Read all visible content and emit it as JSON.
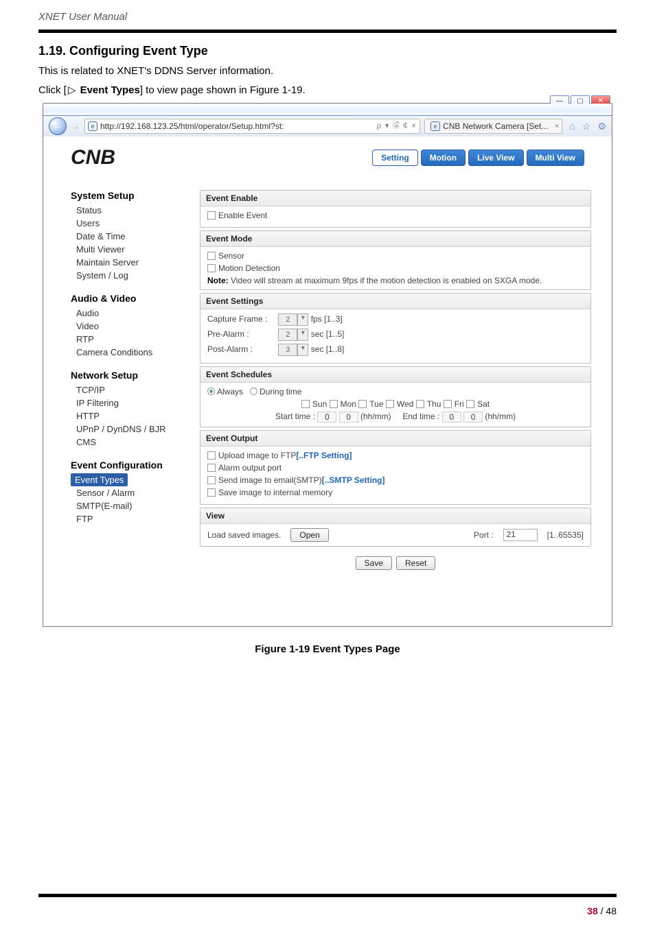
{
  "doc": {
    "header": "XNET User Manual",
    "section_number_title": "1.19. Configuring Event Type",
    "intro_line1": "This is related to XNET's DDNS Server information.",
    "intro_line2_prefix": "Click [",
    "intro_line2_bold": "Event Types",
    "intro_line2_suffix": "] to view page shown in Figure 1-19.",
    "triangle": "▷",
    "caption": "Figure 1-19 Event Types Page",
    "page_label_strong": "38",
    "page_label_rest": " / 48"
  },
  "browser": {
    "url": "http://192.168.123.25/html/operator/Setup.html?st:",
    "url_tail": "ρ ▾ 🗟 ¢ ×",
    "tab_title": "CNB Network Camera [Set...",
    "tab_close": "×",
    "win_min": "—",
    "win_max": "▢",
    "win_close": "✕",
    "toolicons": {
      "home": "⌂",
      "star": "☆",
      "gear": "⚙"
    }
  },
  "band": {
    "logo": "CNB",
    "buttons": {
      "setting": "Setting",
      "motion": "Motion",
      "liveview": "Live View",
      "multiview": "Multi View"
    }
  },
  "sidebar": {
    "groups": [
      {
        "heading": "System Setup",
        "items": [
          "Status",
          "Users",
          "Date & Time",
          "Multi Viewer",
          "Maintain Server",
          "System / Log"
        ]
      },
      {
        "heading": "Audio & Video",
        "items": [
          "Audio",
          "Video",
          "RTP",
          "Camera Conditions"
        ]
      },
      {
        "heading": "Network Setup",
        "items": [
          "TCP/IP",
          "IP Filtering",
          "HTTP",
          "UPnP / DynDNS / BJR",
          "CMS"
        ]
      },
      {
        "heading": "Event Configuration",
        "items": [
          "Event Types",
          "Sensor / Alarm",
          "SMTP(E-mail)",
          "FTP"
        ],
        "active_index": 0
      }
    ]
  },
  "panel": {
    "event_enable": {
      "heading": "Event Enable",
      "enable_label": "Enable Event"
    },
    "event_mode": {
      "heading": "Event Mode",
      "sensor_label": "Sensor",
      "motion_label": "Motion Detection",
      "note_bold": "Note:",
      "note_text": " Video will stream at maximum 9fps if the motion detection is enabled on SXGA mode."
    },
    "event_settings": {
      "heading": "Event Settings",
      "capture_label": "Capture Frame :",
      "capture_val": "2",
      "capture_unit": "fps [1..3]",
      "prealarm_label": "Pre-Alarm :",
      "prealarm_val": "2",
      "prealarm_unit": "sec [1..5]",
      "postalarm_label": "Post-Alarm :",
      "postalarm_val": "3",
      "postalarm_unit": "sec [1..8]"
    },
    "event_schedules": {
      "heading": "Event Schedules",
      "always_label": "Always",
      "during_label": "During time",
      "days": [
        "Sun",
        "Mon",
        "Tue",
        "Wed",
        "Thu",
        "Fri",
        "Sat"
      ],
      "start_label": "Start time :",
      "start_h": "0",
      "start_m": "0",
      "end_label": "End time :",
      "end_h": "0",
      "end_m": "0",
      "hhmm": "(hh/mm)"
    },
    "event_output": {
      "heading": "Event Output",
      "upload_prefix": "Upload image to FTP",
      "upload_link": "[..FTP Setting]",
      "alarm_label": "Alarm output port",
      "smtp_prefix": "Send image to email(SMTP)",
      "smtp_link": "[..SMTP Setting]",
      "save_label": "Save image to internal memory"
    },
    "view": {
      "heading": "View",
      "load_label": "Load saved images.",
      "open_btn": "Open",
      "port_label": "Port :",
      "port_val": "21",
      "port_range": "[1..65535]"
    },
    "buttons": {
      "save": "Save",
      "reset": "Reset"
    }
  }
}
